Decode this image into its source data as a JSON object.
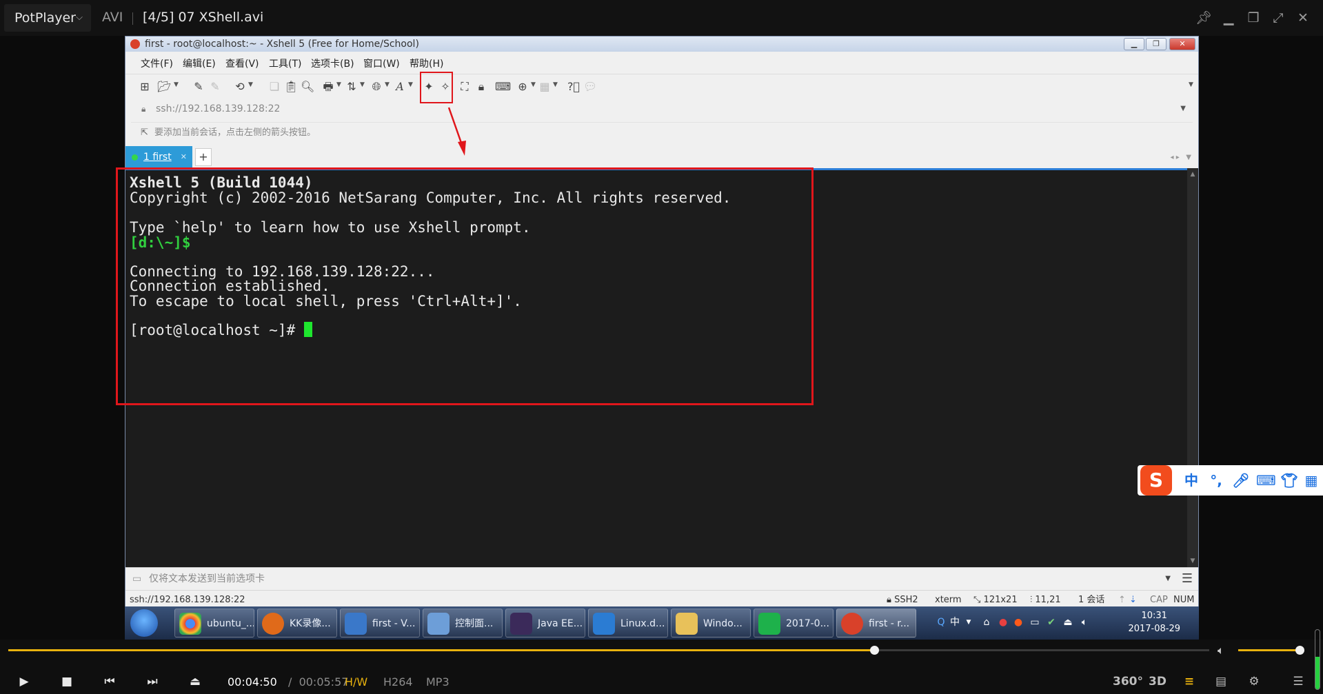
{
  "player": {
    "brand": "PotPlayer",
    "format": "AVI",
    "file_title": "[4/5] 07 XShell.avi",
    "current_time": "00:04:50",
    "time_separator": "/",
    "duration": "00:05:57",
    "tags": [
      "H/W",
      "H264",
      "MP3"
    ],
    "right_buttons": [
      "360°",
      "3D"
    ],
    "seek_progress": 0.721,
    "volume_level": 0.93,
    "level_meter": 0.55,
    "accent": "#e9b20e"
  },
  "xshell": {
    "window_title": "first - root@localhost:~ - Xshell 5 (Free for Home/School)",
    "menu": [
      "文件(F)",
      "编辑(E)",
      "查看(V)",
      "工具(T)",
      "选项卡(B)",
      "窗口(W)",
      "帮助(H)"
    ],
    "address": "ssh://192.168.139.128:22",
    "hint": "要添加当前会话，点击左侧的箭头按钮。",
    "tab_label": "1 first",
    "terminal_lines": [
      "Xshell 5 (Build 1044)",
      "Copyright (c) 2002-2016 NetSarang Computer, Inc. All rights reserved.",
      "",
      "Type `help' to learn how to use Xshell prompt.",
      "[d:\\~]$",
      "",
      "Connecting to 192.168.139.128:22...",
      "Connection established.",
      "To escape to local shell, press 'Ctrl+Alt+]'.",
      "",
      "[root@localhost ~]# "
    ],
    "send_bar_text": "仅将文本发送到当前选项卡",
    "status": {
      "address": "ssh://192.168.139.128:22",
      "protocol": "SSH2",
      "term": "xterm",
      "size": "121x21",
      "cursor_pos": "11,21",
      "sessions": "1 会话",
      "cap": "CAP",
      "num": "NUM"
    }
  },
  "taskbar": {
    "buttons": [
      {
        "label": "ubuntu_...",
        "icon": "chrome-icon"
      },
      {
        "label": "KK录像...",
        "icon": "kk-recorder-icon"
      },
      {
        "label": "first - V...",
        "icon": "vmware-icon"
      },
      {
        "label": "控制面...",
        "icon": "control-panel-icon"
      },
      {
        "label": "Java EE...",
        "icon": "eclipse-icon"
      },
      {
        "label": "Linux.d...",
        "icon": "word-icon"
      },
      {
        "label": "Windo...",
        "icon": "folder-icon"
      },
      {
        "label": "2017-0...",
        "icon": "sheet-icon"
      },
      {
        "label": "first - r...",
        "icon": "xshell-icon"
      }
    ],
    "tray_ime": "中",
    "clock_time": "10:31",
    "clock_date": "2017-08-29"
  },
  "ime": {
    "logo": "S",
    "keys": [
      "中",
      "°,",
      "🎤",
      "⌨",
      "👕",
      "▦"
    ]
  }
}
